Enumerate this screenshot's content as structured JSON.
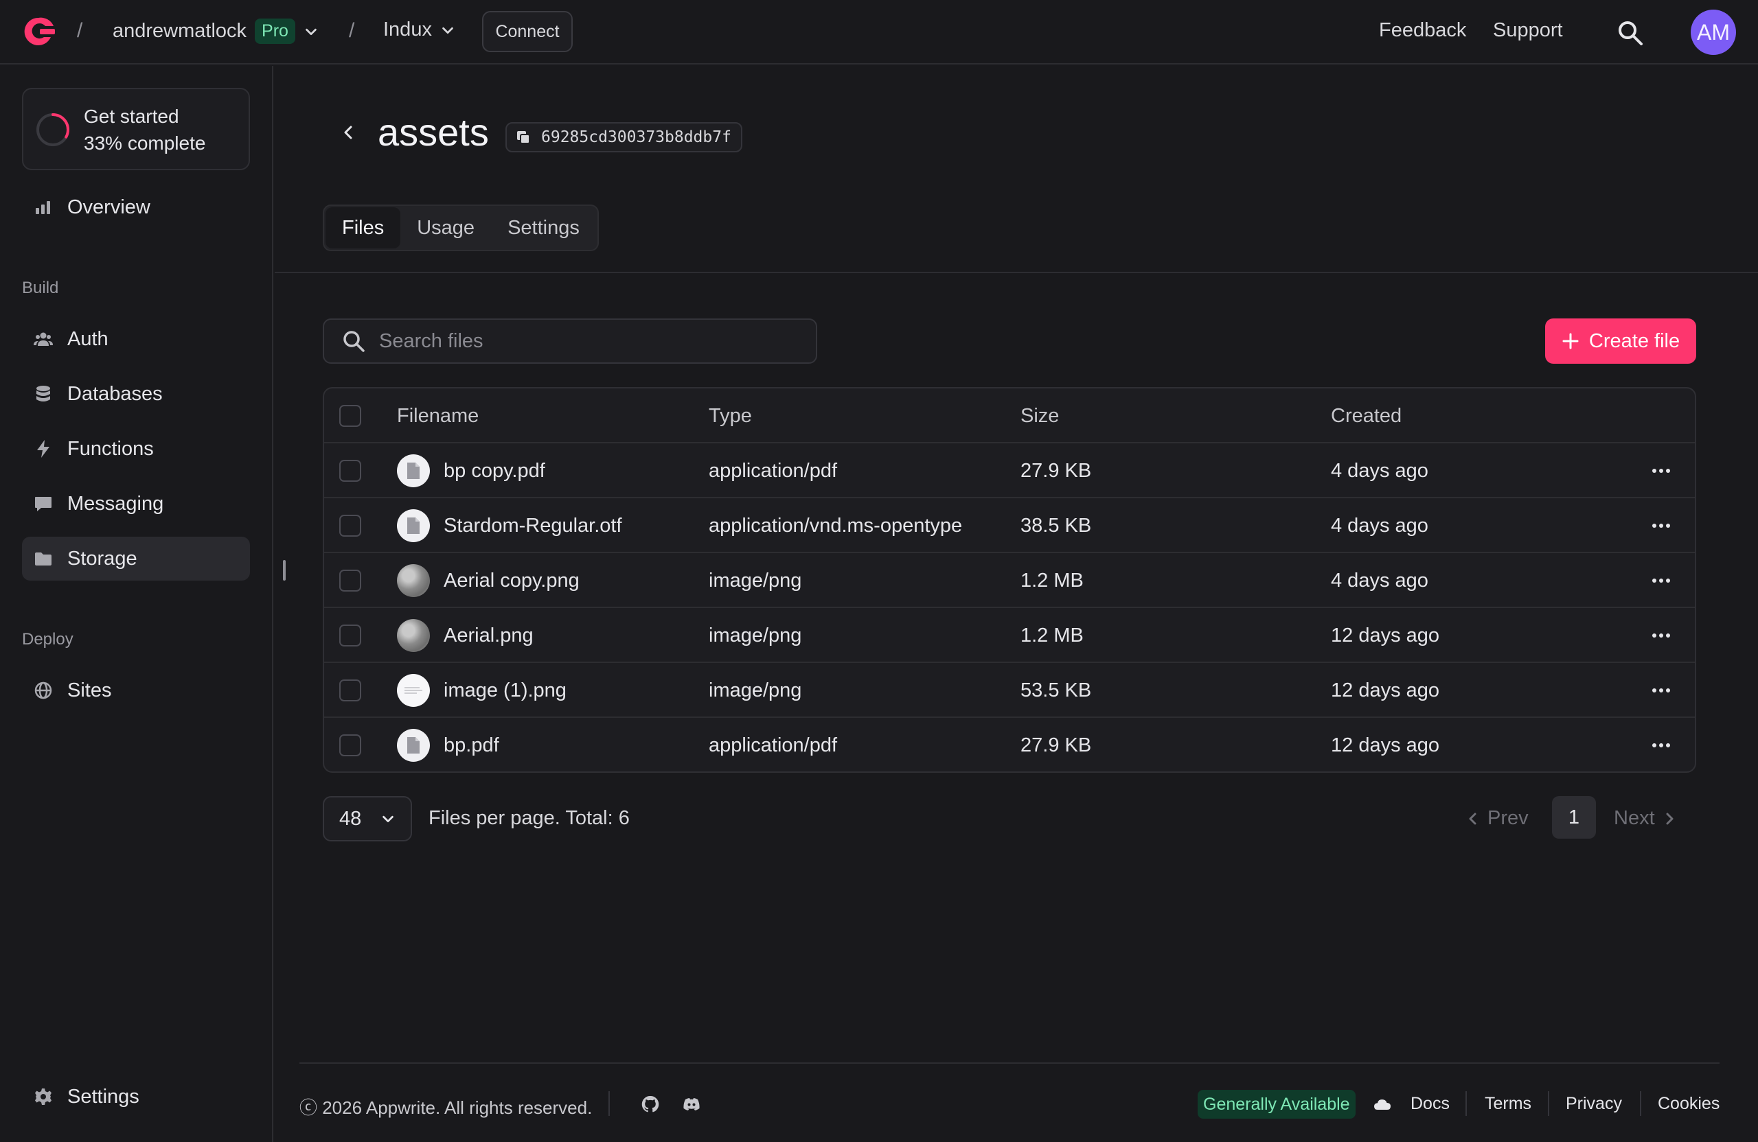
{
  "header": {
    "org": "andrewmatlock",
    "plan_badge": "Pro",
    "project": "Indux",
    "connect_label": "Connect",
    "feedback_label": "Feedback",
    "support_label": "Support",
    "avatar_initials": "AM",
    "brand_color": "#fd366e",
    "avatar_color": "#7c5cf5"
  },
  "sidebar": {
    "get_started": {
      "title": "Get started",
      "progress_label": "33% complete",
      "progress": 0.33
    },
    "overview": "Overview",
    "build_label": "Build",
    "build_items": [
      {
        "label": "Auth",
        "icon": "users-icon"
      },
      {
        "label": "Databases",
        "icon": "database-icon"
      },
      {
        "label": "Functions",
        "icon": "lightning-icon"
      },
      {
        "label": "Messaging",
        "icon": "chat-icon"
      },
      {
        "label": "Storage",
        "icon": "folder-icon",
        "active": true
      }
    ],
    "deploy_label": "Deploy",
    "deploy_items": [
      {
        "label": "Sites",
        "icon": "globe-icon"
      }
    ],
    "settings": "Settings"
  },
  "page": {
    "title": "assets",
    "bucket_id": "69285cd300373b8ddb7f",
    "tabs": [
      {
        "label": "Files",
        "active": true
      },
      {
        "label": "Usage",
        "active": false
      },
      {
        "label": "Settings",
        "active": false
      }
    ]
  },
  "files": {
    "search_placeholder": "Search files",
    "create_label": "Create file",
    "columns": {
      "filename": "Filename",
      "type": "Type",
      "size": "Size",
      "created": "Created"
    },
    "rows": [
      {
        "name": "bp copy.pdf",
        "type": "application/pdf",
        "size": "27.9 KB",
        "created": "4 days ago",
        "thumb": "file"
      },
      {
        "name": "Stardom-Regular.otf",
        "type": "application/vnd.ms-opentype",
        "size": "38.5 KB",
        "created": "4 days ago",
        "thumb": "file"
      },
      {
        "name": "Aerial copy.png",
        "type": "image/png",
        "size": "1.2 MB",
        "created": "4 days ago",
        "thumb": "photo"
      },
      {
        "name": "Aerial.png",
        "type": "image/png",
        "size": "1.2 MB",
        "created": "12 days ago",
        "thumb": "photo"
      },
      {
        "name": "image (1).png",
        "type": "image/png",
        "size": "53.5 KB",
        "created": "12 days ago",
        "thumb": "doc"
      },
      {
        "name": "bp.pdf",
        "type": "application/pdf",
        "size": "27.9 KB",
        "created": "12 days ago",
        "thumb": "file"
      }
    ]
  },
  "pagination": {
    "per_page": "48",
    "summary": "Files per page. Total: 6",
    "prev_label": "Prev",
    "current_page": "1",
    "next_label": "Next"
  },
  "footer": {
    "copyright": "ⓒ 2026 Appwrite. All rights reserved.",
    "status_badge": "Generally Available",
    "docs": "Docs",
    "terms": "Terms",
    "privacy": "Privacy",
    "cookies": "Cookies"
  }
}
